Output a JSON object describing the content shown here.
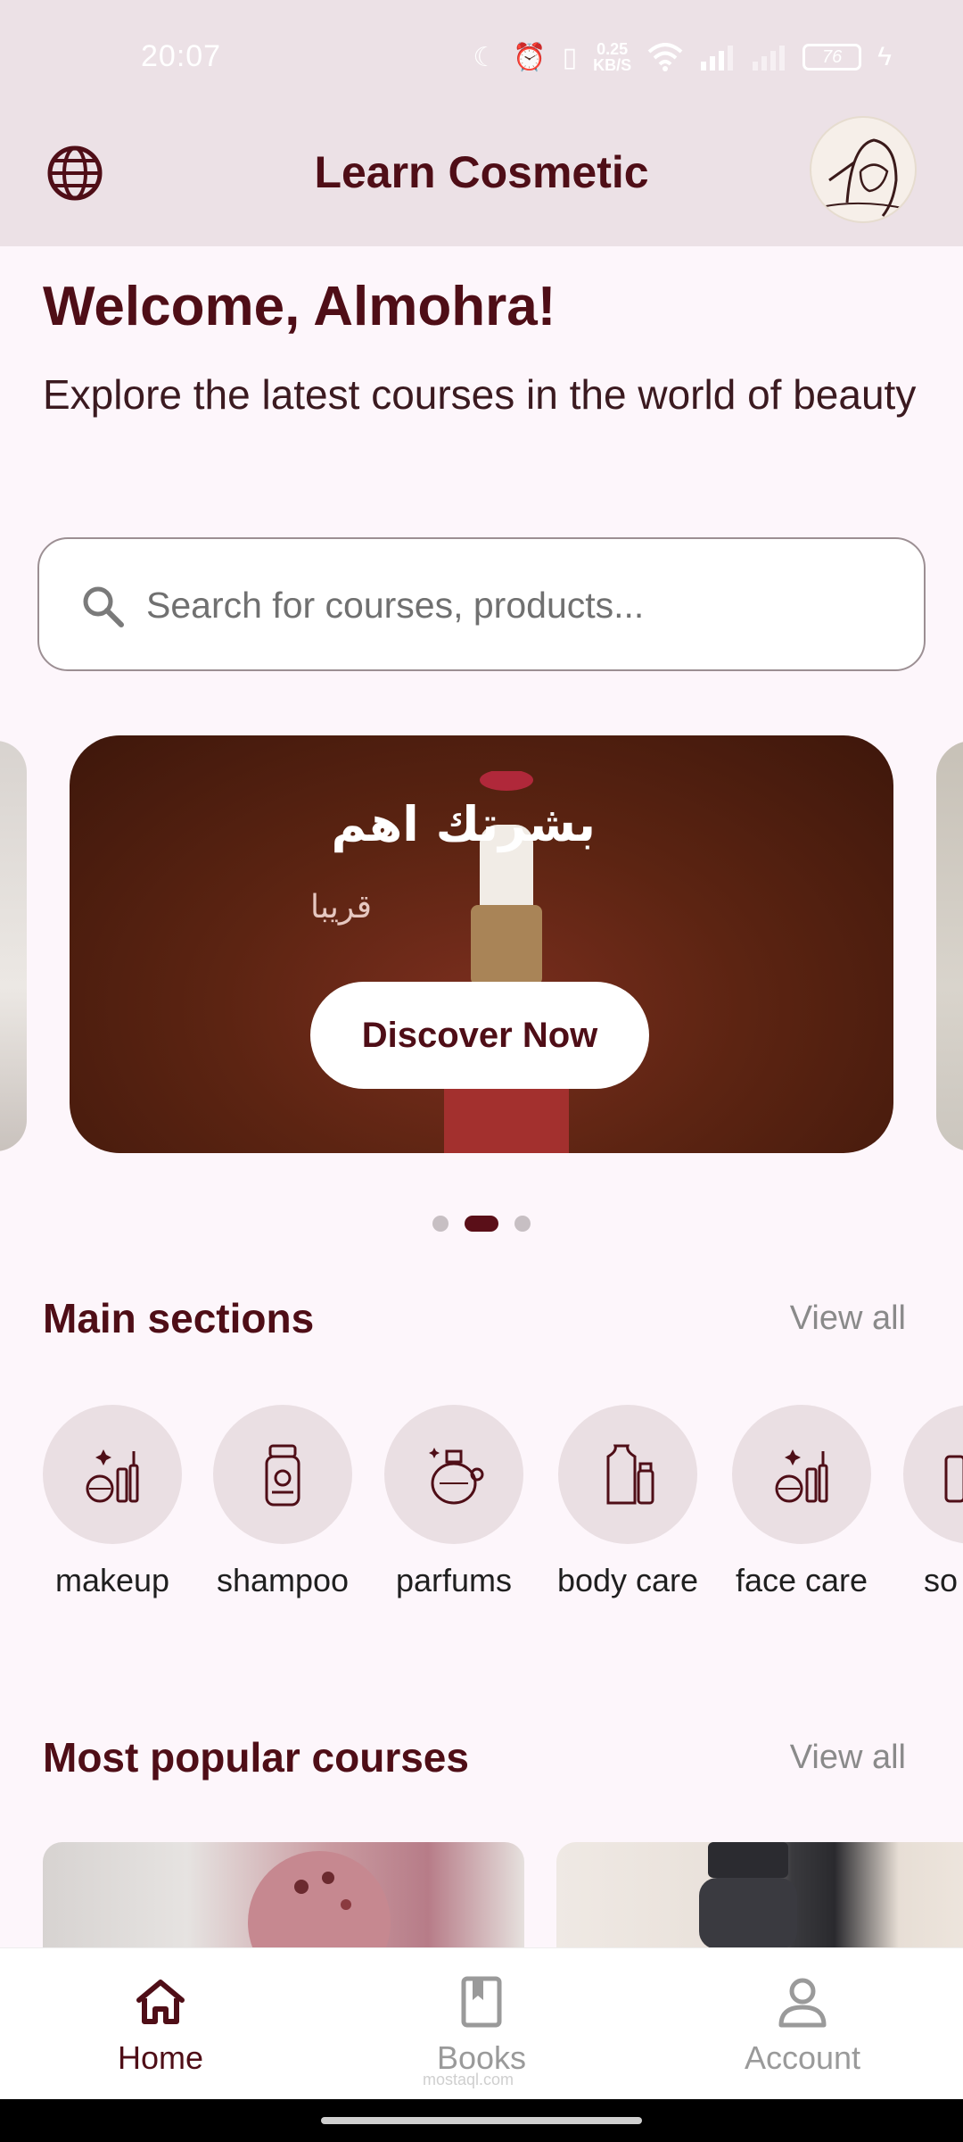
{
  "status_bar": {
    "time": "20:07",
    "net_speed": "0.25",
    "net_unit": "KB/S",
    "battery": "76"
  },
  "app_bar": {
    "title": "Learn Cosmetic"
  },
  "welcome": {
    "title": "Welcome, Almohra!",
    "subtitle": "Explore the latest courses in the world of beauty"
  },
  "search": {
    "placeholder": "Search for courses, products..."
  },
  "banner": {
    "title": "بشرتك اهم",
    "subtitle": "قريبا",
    "button_label": "Discover Now",
    "active_index": 1,
    "count": 3
  },
  "sections": {
    "main": {
      "title": "Main sections",
      "view_all": "View all"
    },
    "popular": {
      "title": "Most popular courses",
      "view_all": "View all"
    }
  },
  "categories": [
    {
      "label": "makeup",
      "icon": "makeup-icon"
    },
    {
      "label": "shampoo",
      "icon": "shampoo-icon"
    },
    {
      "label": "parfums",
      "icon": "perfume-icon"
    },
    {
      "label": "body care",
      "icon": "body-care-icon"
    },
    {
      "label": "face care",
      "icon": "face-care-icon"
    },
    {
      "label": "so",
      "icon": "soap-icon"
    }
  ],
  "bottom_nav": [
    {
      "label": "Home",
      "icon": "home-icon",
      "active": true
    },
    {
      "label": "Books",
      "icon": "book-icon",
      "active": false
    },
    {
      "label": "Account",
      "icon": "account-icon",
      "active": false
    }
  ],
  "watermark": "mostaql.com",
  "colors": {
    "primary": "#4f0e17",
    "app_bar_bg": "#ece1e6",
    "page_bg": "#fdf6fb",
    "category_bg": "#eadfe3"
  }
}
